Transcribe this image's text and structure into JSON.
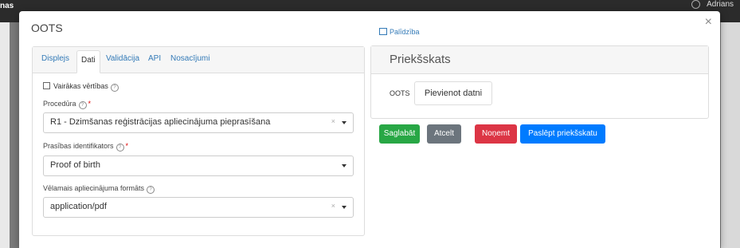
{
  "topbar": {
    "left_text": "nas",
    "user_name": "Adrians"
  },
  "modal": {
    "title": "OOTS",
    "close_symbol": "×"
  },
  "help": {
    "label": "Palīdzība"
  },
  "tabs": [
    {
      "label": "Displejs"
    },
    {
      "label": "Dati"
    },
    {
      "label": "Validācija"
    },
    {
      "label": "API"
    },
    {
      "label": "Nosacījumi"
    }
  ],
  "form": {
    "multiple_values_label": "Vairākas vērtības",
    "procedure_label": "Procedūra",
    "procedure_value": "R1 - Dzimšanas reģistrācijas apliecinājuma pieprasīšana",
    "requirement_label": "Prasības identifikators",
    "requirement_value": "Proof of birth",
    "format_label": "Vēlamais apliecinājuma formāts",
    "format_value": "application/pdf",
    "clear_symbol": "×",
    "help_symbol": "?",
    "required_symbol": "*"
  },
  "preview": {
    "title": "Priekšskats",
    "oots_label": "OOTS",
    "add_file_label": "Pievienot datni"
  },
  "buttons": {
    "save": "Saglabāt",
    "cancel": "Atcelt",
    "remove": "Noņemt",
    "hide_preview": "Paslēpt priekšskatu"
  },
  "icons": {
    "help_icon": "book-edit-icon",
    "close_icon": "close-icon",
    "user_icon": "user-circle-icon"
  },
  "colors": {
    "save": "#28a745",
    "cancel": "#6c757d",
    "remove": "#dc3545",
    "primary": "#007bff",
    "link": "#337ab7"
  }
}
